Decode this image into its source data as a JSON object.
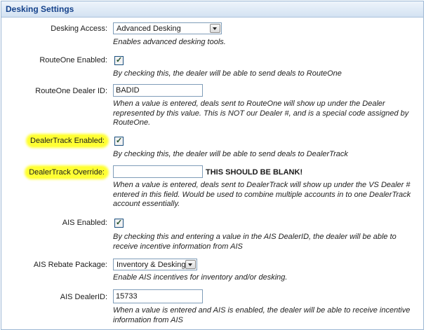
{
  "panel": {
    "title": "Desking Settings"
  },
  "desking_access": {
    "label": "Desking Access:",
    "value": "Advanced Desking",
    "description": "Enables advanced desking tools."
  },
  "routeone_enabled": {
    "label": "RouteOne Enabled:",
    "checked": true,
    "description": "By checking this, the dealer will be able to send deals to RouteOne"
  },
  "routeone_dealer_id": {
    "label": "RouteOne Dealer ID:",
    "value": "BADID",
    "description": "When a value is entered, deals sent to RouteOne will show up under the Dealer represented by this value. This is NOT our Dealer #, and is a special code assigned by RouteOne."
  },
  "dealertrack_enabled": {
    "label": "DealerTrack Enabled:",
    "checked": true,
    "description": "By checking this, the dealer will be able to send deals to DealerTrack"
  },
  "dealertrack_override": {
    "label": "DealerTrack Override:",
    "value": "",
    "note": "THIS SHOULD BE BLANK!",
    "description": "When a value is entered, deals sent to DealerTrack will show up under the VS Dealer # entered in this field. Would be used to combine multiple accounts in to one DealerTrack account essentially."
  },
  "ais_enabled": {
    "label": "AIS Enabled:",
    "checked": true,
    "description": "By checking this and entering a value in the AIS DealerID, the dealer will be able to receive incentive information from AIS"
  },
  "ais_rebate_package": {
    "label": "AIS Rebate Package:",
    "value": "Inventory & Desking",
    "description": "Enable AIS incentives for inventory and/or desking."
  },
  "ais_dealer_id": {
    "label": "AIS DealerID:",
    "value": "15733",
    "description": "When a value is entered and AIS is enabled, the dealer will be able to receive incentive information from AIS"
  },
  "colors": {
    "header_text": "#15428b",
    "highlight": "#ffff33",
    "input_border": "#7f9db9"
  }
}
